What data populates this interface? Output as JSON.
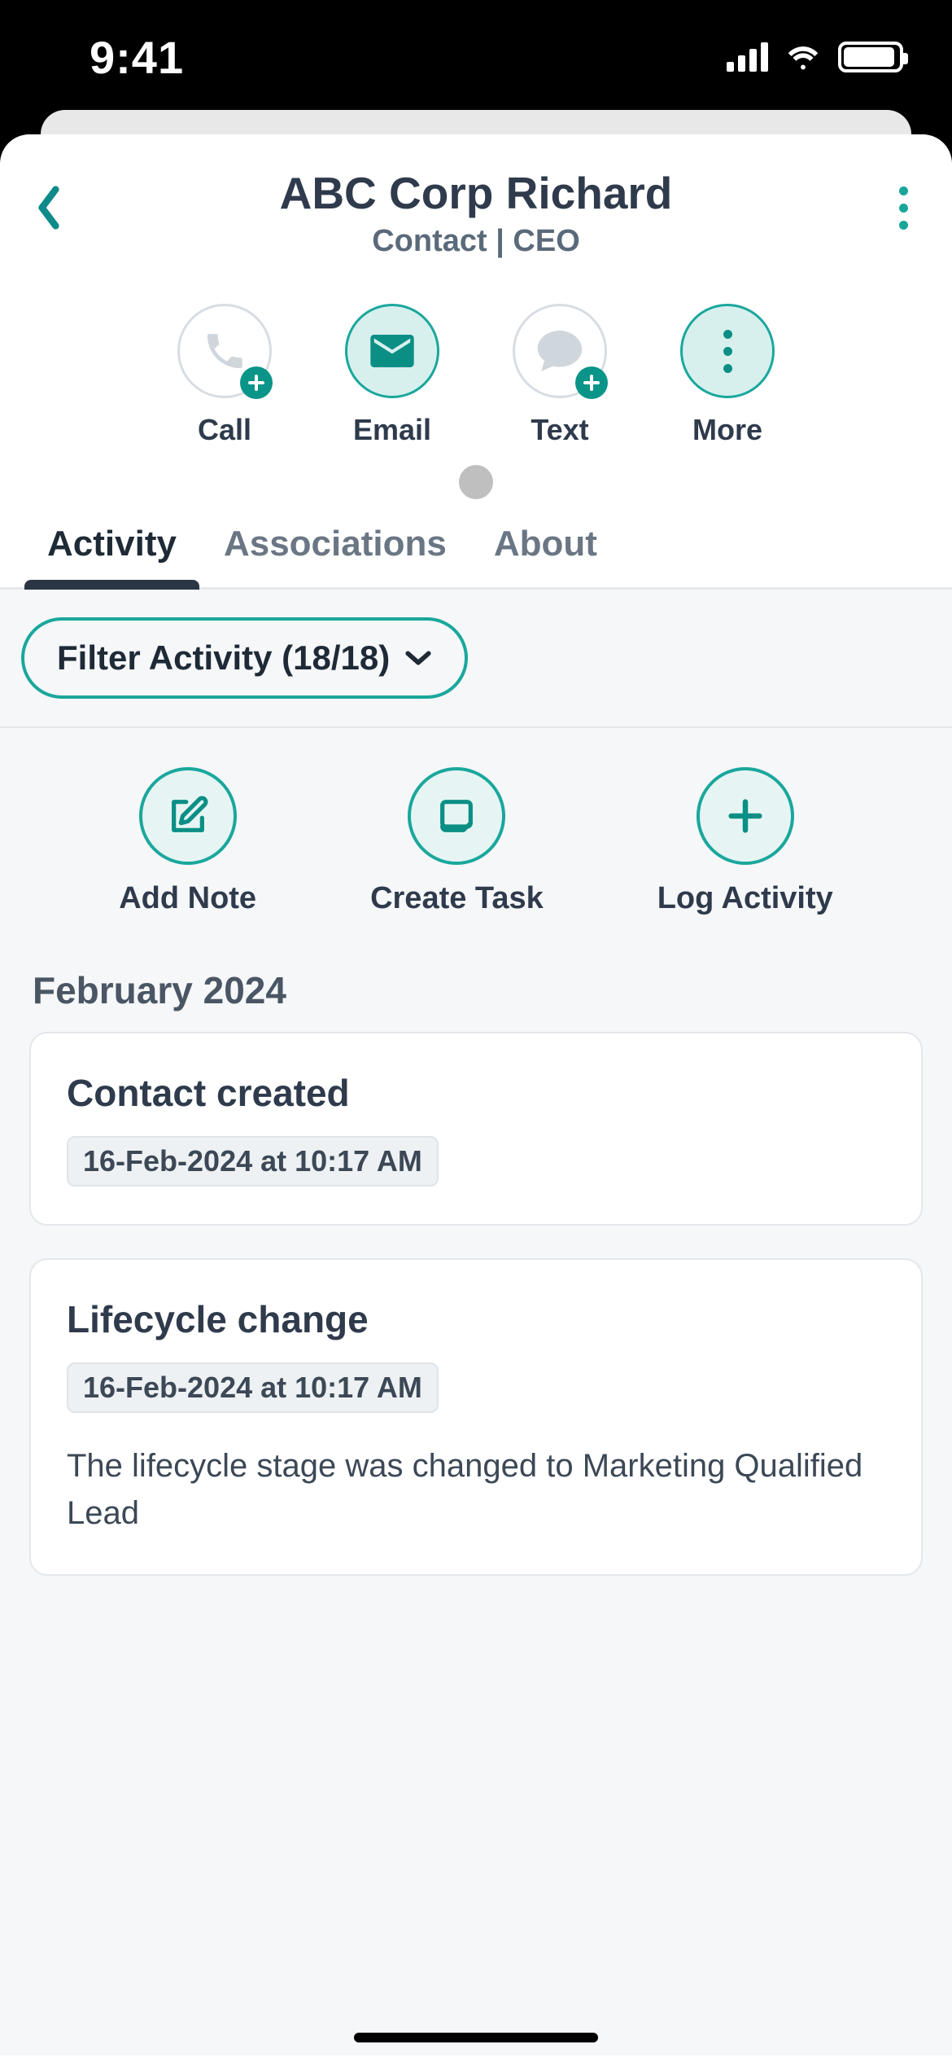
{
  "status": {
    "time": "9:41"
  },
  "header": {
    "title": "ABC Corp Richard",
    "subtitle": "Contact | CEO"
  },
  "quick_actions": {
    "call": "Call",
    "email": "Email",
    "text": "Text",
    "more": "More"
  },
  "tabs": {
    "activity": "Activity",
    "associations": "Associations",
    "about": "About"
  },
  "filter": {
    "label": "Filter Activity (18/18)"
  },
  "tools": {
    "add_note": "Add Note",
    "create_task": "Create Task",
    "log_activity": "Log Activity"
  },
  "timeline": {
    "month": "February 2024",
    "cards": [
      {
        "title": "Contact created",
        "ts": "16-Feb-2024 at 10:17 AM",
        "desc": ""
      },
      {
        "title": "Lifecycle change",
        "ts": "16-Feb-2024 at 10:17 AM",
        "desc": "The lifecycle stage was changed to Marketing Qualified Lead"
      }
    ]
  }
}
